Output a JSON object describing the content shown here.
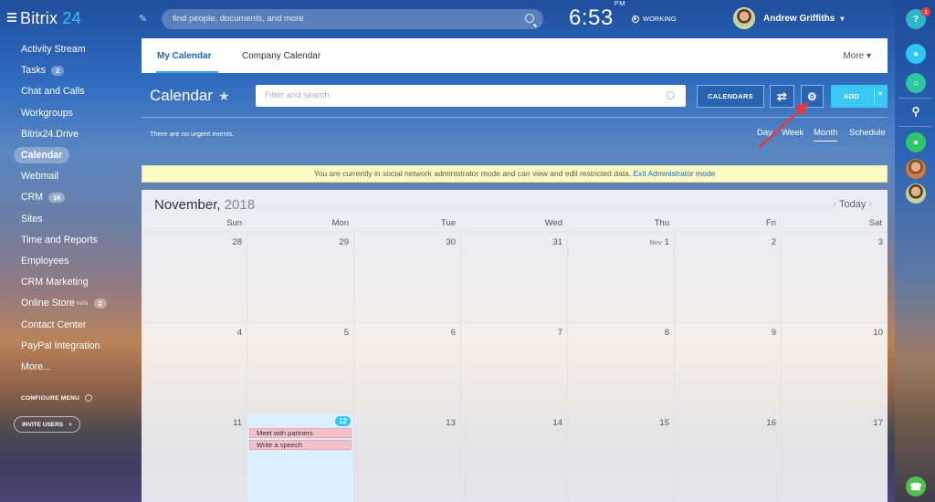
{
  "app": {
    "name": "Bitrix",
    "name_suffix": "24"
  },
  "sidebar": {
    "items": [
      {
        "label": "Activity Stream",
        "badge": ""
      },
      {
        "label": "Tasks",
        "badge": "2"
      },
      {
        "label": "Chat and Calls",
        "badge": ""
      },
      {
        "label": "Workgroups",
        "badge": ""
      },
      {
        "label": "Bitrix24.Drive",
        "badge": ""
      },
      {
        "label": "Calendar",
        "badge": "",
        "active": true
      },
      {
        "label": "Webmail",
        "badge": ""
      },
      {
        "label": "CRM",
        "badge": "16"
      },
      {
        "label": "Sites",
        "badge": ""
      },
      {
        "label": "Time and Reports",
        "badge": ""
      },
      {
        "label": "Employees",
        "badge": ""
      },
      {
        "label": "CRM Marketing",
        "badge": ""
      },
      {
        "label": "Online Store",
        "badge": "2",
        "tag": "beta"
      },
      {
        "label": "Contact Center",
        "badge": ""
      },
      {
        "label": "PayPal Integration",
        "badge": ""
      },
      {
        "label": "More... ",
        "badge": ""
      }
    ],
    "configure_menu": "CONFIGURE MENU",
    "invite_users": "INVITE USERS"
  },
  "header": {
    "search_placeholder": "find people, documents, and more",
    "time": "6:53",
    "ampm": "PM",
    "status": "WORKING",
    "user_name": "Andrew Griffiths"
  },
  "right_rail": {
    "help_label": "?",
    "help_badge": "1"
  },
  "tabs": [
    {
      "label": "My Calendar"
    },
    {
      "label": "Company Calendar"
    }
  ],
  "more_label": "More",
  "toolbar": {
    "title": "Calendar",
    "filter_placeholder": "Filter and search",
    "calendars_button": "CALENDARS",
    "add_button": "ADD"
  },
  "urgent_text": "There are no urgent events.",
  "views": [
    "Day",
    "Week",
    "Month",
    "Schedule"
  ],
  "notice": {
    "text": "You are currently in social network administrator mode and can view and edit restricted data.",
    "link": "Exit Administrator mode"
  },
  "calendar": {
    "month": "November,",
    "year": "2018",
    "today_label": "Today",
    "weekdays": [
      "Sun",
      "Mon",
      "Tue",
      "Wed",
      "Thu",
      "Fri",
      "Sat"
    ],
    "weeks": [
      [
        "28",
        "29",
        "30",
        "31",
        "1",
        "2",
        "3"
      ],
      [
        "4",
        "5",
        "6",
        "7",
        "8",
        "9",
        "10"
      ],
      [
        "11",
        "12",
        "13",
        "14",
        "15",
        "16",
        "17"
      ]
    ],
    "month_label_cell": "Nov",
    "today_date": "12",
    "events": [
      "Meet with partners",
      "Write a speech"
    ]
  },
  "colors": {
    "accent": "#2fc6f6",
    "primary_button": "#2a63b0",
    "event": "#f2c2c8",
    "notice": "#fafac4",
    "annotation_arrow": "#e23b3b"
  }
}
